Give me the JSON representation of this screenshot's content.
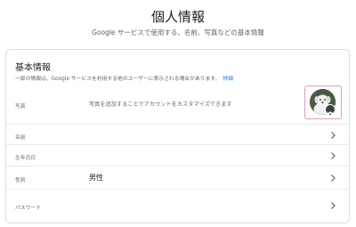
{
  "header": {
    "title": "個人情報",
    "subtitle": "Google サービスで使用する、名前、写真などの基本情報"
  },
  "card": {
    "title": "基本情報",
    "description": "一部の情報は、Google サービスを利用する他のユーザーに表示される場合があります。",
    "link": "詳細",
    "photo": {
      "label": "写真",
      "hint": "写真を追加することでアカウントをカスタマイズできます"
    },
    "rows": [
      {
        "label": "名前",
        "value": ""
      },
      {
        "label": "生年月日",
        "value": ""
      },
      {
        "label": "性別",
        "value": "男性"
      },
      {
        "label": "パスワード",
        "value": ""
      }
    ]
  },
  "colors": {
    "link": "#1a73e8",
    "avatar_highlight": "#e89cb6",
    "border": "#dadce0"
  },
  "icons": {
    "row_chevron": "chevron-right-icon",
    "photo_badge": "camera-icon"
  }
}
